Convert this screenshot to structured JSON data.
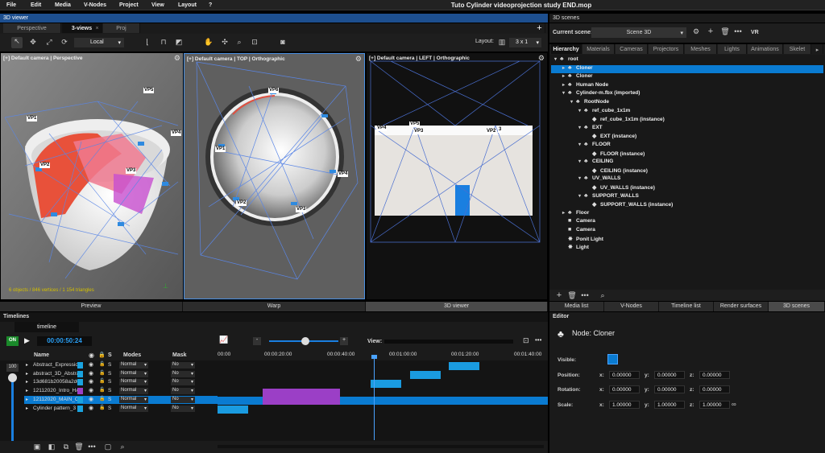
{
  "menu": [
    "File",
    "Edit",
    "Media",
    "V-Nodes",
    "Project",
    "View",
    "Layout",
    "?"
  ],
  "window_title": "Tuto Cylinder videoprojection study END.mop",
  "viewer": {
    "panel_title": "3D viewer",
    "tabs": [
      "Perspective",
      "3-views",
      "Proj"
    ],
    "tab_close": "×",
    "add_glyph": "+",
    "mode_select": "Local",
    "layout_label": "Layout:",
    "layout_value": "3 x 1",
    "viewports": [
      {
        "label": "[+] Default camera | Perspective",
        "stats": "6 objects / 846 vertices / 1 154 triangles"
      },
      {
        "label": "[+] Default camera | TOP | Orthographic"
      },
      {
        "label": "[+] Default camera | LEFT | Orthographic"
      }
    ],
    "vp_labels": {
      "perspective": [
        "VP1",
        "VP2",
        "VP3",
        "VP4",
        "VP5"
      ],
      "top": [
        "VP6",
        "VP1",
        "VP2",
        "VP3",
        "VP4"
      ],
      "left": [
        "VP4",
        "VP5",
        "VP3",
        "VP2",
        "3"
      ]
    },
    "bottom_tabs": [
      "Preview",
      "Warp",
      "3D viewer"
    ]
  },
  "timelines": {
    "panel_title": "Timelines",
    "tab": "timeline",
    "on": "ON",
    "time": "00:00:50:24",
    "col_name": "Name",
    "col_s": "S",
    "col_modes": "Modes",
    "col_mask": "Mask",
    "view_label": "View:",
    "volume": "100",
    "ruler": [
      "00:00",
      "00:00:20:00",
      "00:00:40:00",
      "00:01:00:00",
      "00:01:20:00",
      "00:01:40:00"
    ],
    "tracks": [
      {
        "name": "Abstract_Expressio",
        "color": "#1aa3e0",
        "mode": "Normal",
        "mask": "No"
      },
      {
        "name": "abstract_3D_Abstra",
        "color": "#1aa3e0",
        "mode": "Normal",
        "mask": "No"
      },
      {
        "name": "13d681b20058a2d6",
        "color": "#1aa3e0",
        "mode": "Normal",
        "mask": "No"
      },
      {
        "name": "12112020_Intro_HA",
        "color": "#9b3fc6",
        "mode": "Normal",
        "mask": "No"
      },
      {
        "name": "12112020_MAIN_Ce",
        "color": "#1aa3e0",
        "mode": "Normal",
        "mask": "No"
      },
      {
        "name": "Cylinder pattern_3",
        "color": "#1aa3e0",
        "mode": "Normal",
        "mask": "No"
      }
    ]
  },
  "scenes": {
    "panel_title": "3D scenes",
    "current_label": "Current scene:",
    "current_value": "Scene 3D",
    "vr": "VR",
    "tabs": [
      "Hierarchy",
      "Materials",
      "Cameras",
      "Projectors",
      "Meshes",
      "Lights",
      "Animations",
      "Skelet"
    ],
    "tree": [
      {
        "label": "root",
        "depth": 0,
        "arrow": "▾",
        "icon": "♣"
      },
      {
        "label": "Cloner",
        "depth": 1,
        "arrow": "▸",
        "icon": "♣",
        "selected": true
      },
      {
        "label": "Cloner",
        "depth": 1,
        "arrow": "▸",
        "icon": "♣"
      },
      {
        "label": "Human Node",
        "depth": 1,
        "arrow": "▸",
        "icon": "♣"
      },
      {
        "label": "Cylinder-m.fbx (imported)",
        "depth": 1,
        "arrow": "▾",
        "icon": "♣"
      },
      {
        "label": "RootNode",
        "depth": 2,
        "arrow": "▾",
        "icon": "♣"
      },
      {
        "label": "ref_cube_1x1m",
        "depth": 3,
        "arrow": "▾",
        "icon": "♣"
      },
      {
        "label": "ref_cube_1x1m (instance)",
        "depth": 4,
        "arrow": "",
        "icon": "◆"
      },
      {
        "label": "EXT",
        "depth": 3,
        "arrow": "▾",
        "icon": "♣"
      },
      {
        "label": "EXT (instance)",
        "depth": 4,
        "arrow": "",
        "icon": "◆"
      },
      {
        "label": "FLOOR",
        "depth": 3,
        "arrow": "▾",
        "icon": "♣"
      },
      {
        "label": "FLOOR (instance)",
        "depth": 4,
        "arrow": "",
        "icon": "◆"
      },
      {
        "label": "CEILING",
        "depth": 3,
        "arrow": "▾",
        "icon": "♣"
      },
      {
        "label": "CEILING (instance)",
        "depth": 4,
        "arrow": "",
        "icon": "◆"
      },
      {
        "label": "UV_WALLS",
        "depth": 3,
        "arrow": "▾",
        "icon": "♣"
      },
      {
        "label": "UV_WALLS (instance)",
        "depth": 4,
        "arrow": "",
        "icon": "◆"
      },
      {
        "label": "SUPPORT_WALLS",
        "depth": 3,
        "arrow": "▾",
        "icon": "♣"
      },
      {
        "label": "SUPPORT_WALLS (instance)",
        "depth": 4,
        "arrow": "",
        "icon": "◆"
      },
      {
        "label": "Floor",
        "depth": 1,
        "arrow": "▸",
        "icon": "♣"
      },
      {
        "label": "Camera",
        "depth": 1,
        "arrow": "",
        "icon": "■"
      },
      {
        "label": "Camera",
        "depth": 1,
        "arrow": "",
        "icon": "■"
      },
      {
        "label": "Ponit Light",
        "depth": 1,
        "arrow": "",
        "icon": "✸"
      },
      {
        "label": "Light",
        "depth": 1,
        "arrow": "",
        "icon": "✸"
      }
    ],
    "bottom_tabs": [
      "Media list",
      "V-Nodes",
      "Timeline list",
      "Render surfaces",
      "3D scenes"
    ]
  },
  "editor": {
    "panel_title": "Editor",
    "node_title": "Node: Cloner",
    "visible_label": "Visible:",
    "position_label": "Position:",
    "rotation_label": "Rotation:",
    "scale_label": "Scale:",
    "axis": [
      "x:",
      "y:",
      "z:"
    ],
    "position": [
      "0.00000",
      "0.00000",
      "0.00000"
    ],
    "rotation": [
      "0.00000",
      "0.00000",
      "0.00000"
    ],
    "scale": [
      "1.00000",
      "1.00000",
      "1.00000"
    ]
  }
}
